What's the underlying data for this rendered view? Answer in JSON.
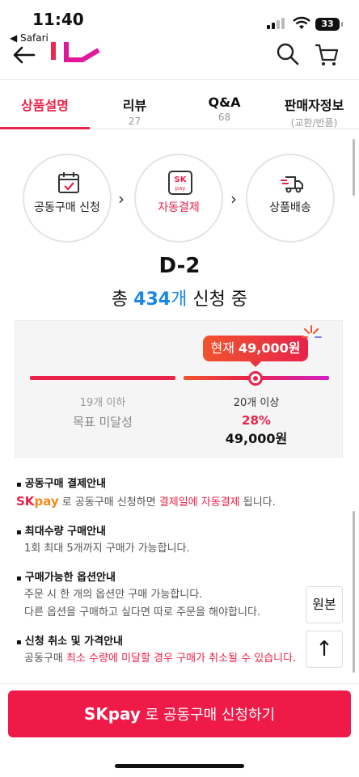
{
  "status": {
    "time": "11:40",
    "back_app": "◀ Safari",
    "battery": "33"
  },
  "tabs": [
    {
      "label": "상품설명",
      "sub": ""
    },
    {
      "label": "리뷰",
      "sub": "27"
    },
    {
      "label": "Q&A",
      "sub": "68"
    },
    {
      "label": "판매자정보",
      "sub": "(교환/반품)"
    }
  ],
  "steps": [
    {
      "label": "공동구매 신청"
    },
    {
      "label": "자동결제"
    },
    {
      "label": "상품배송"
    }
  ],
  "dday": "D-2",
  "count": {
    "prefix": "총 ",
    "number": "434",
    "unit": "개",
    "suffix": " 신청 중"
  },
  "progress": {
    "bubble_prefix": "현재 ",
    "bubble_price": "49,000원",
    "left_count": "19개 이하",
    "left_status": "목표 미달성",
    "right_count": "20개 이상",
    "right_discount": "28%",
    "right_price": "49,000원",
    "current_position": 0.5
  },
  "info": {
    "payment_title": "공동구매 결제안내",
    "payment_sk": "SK",
    "payment_pay": "pay",
    "payment_text1": " 로 공동구매 신청하면 ",
    "payment_highlight": "결제일에 자동결제",
    "payment_text2": " 됩니다.",
    "max_title": "최대수량 구매안내",
    "max_text": "1회 최대 5개까지 구매가 가능합니다.",
    "option_title": "구매가능한 옵션안내",
    "option_text1": "주문 시 한 개의 옵션만 구매 가능합니다.",
    "option_text2": "다른 옵션을 구매하고 싶다면 따로 주문을 해야합니다.",
    "cancel_title": "신청 취소 및 가격안내",
    "cancel_text1": "공동구매 ",
    "cancel_highlight": "최소 수량에 미달할 경우 구매가 취소될 수 있습니다."
  },
  "buttons": {
    "origin": "원본",
    "top": "↑"
  },
  "cta": {
    "sk": "SK",
    "pay": "pay",
    "label": " 로 공동구매 신청하기"
  },
  "colors": {
    "accent": "#e9234a",
    "blue": "#1a86e8",
    "cta": "#f01a48"
  }
}
